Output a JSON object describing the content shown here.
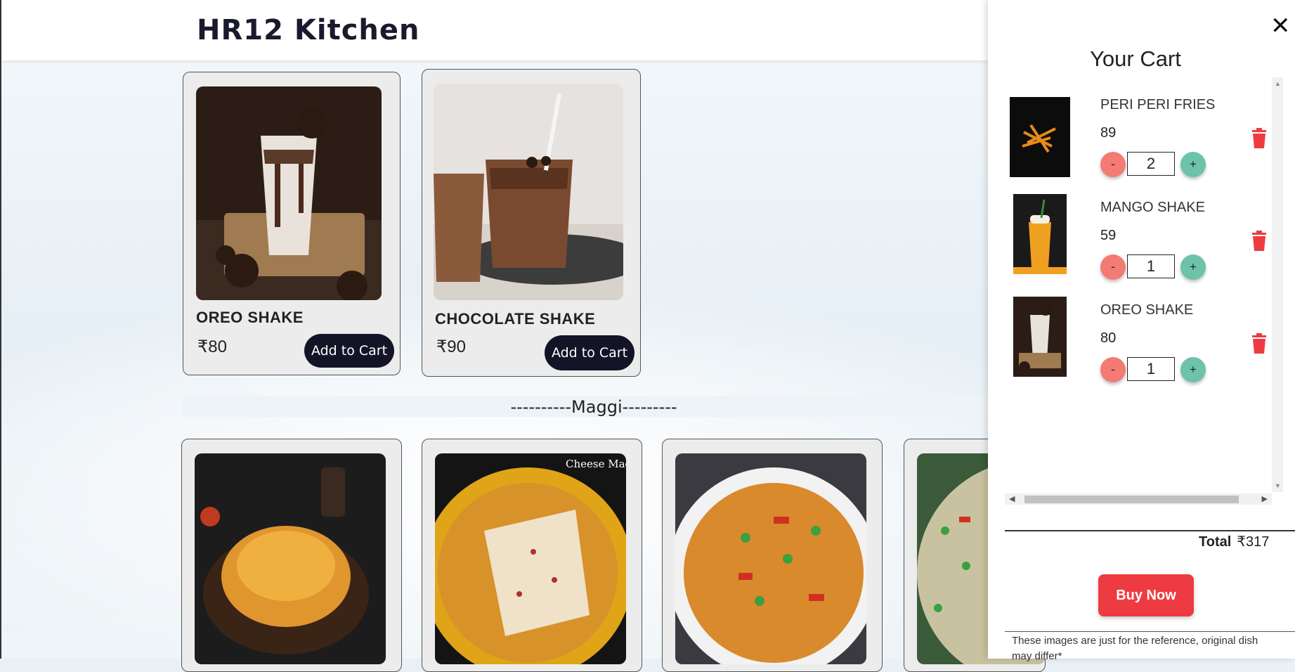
{
  "header": {
    "brand": "HR12 Kitchen"
  },
  "menu": {
    "shakes": [
      {
        "name": "OREO SHAKE",
        "price": "₹80",
        "button": "Add to Cart"
      },
      {
        "name": "CHOCOLATE SHAKE",
        "price": "₹90",
        "button": "Add to Cart"
      }
    ],
    "section_title": "----------Maggi---------",
    "maggi_image_text": "Cheese Maggie"
  },
  "cart": {
    "title": "Your Cart",
    "close_icon": "close-icon",
    "items": [
      {
        "name": "PERI PERI FRIES",
        "price": "89",
        "qty": "2",
        "minus": "-",
        "plus": "+"
      },
      {
        "name": "MANGO SHAKE",
        "price": "59",
        "qty": "1",
        "minus": "-",
        "plus": "+"
      },
      {
        "name": "OREO SHAKE",
        "price": "80",
        "qty": "1",
        "minus": "-",
        "plus": "+"
      }
    ],
    "total_label": "Total",
    "total_value": "₹317",
    "buy_label": "Buy Now",
    "note": "These images are just for the reference, original dish may differ*"
  },
  "colors": {
    "accent_dark": "#141427",
    "buy_red": "#ee3b41",
    "minus_salmon": "#f37b74",
    "plus_teal": "#6cc3aa",
    "trash_red": "#ee3b41"
  }
}
